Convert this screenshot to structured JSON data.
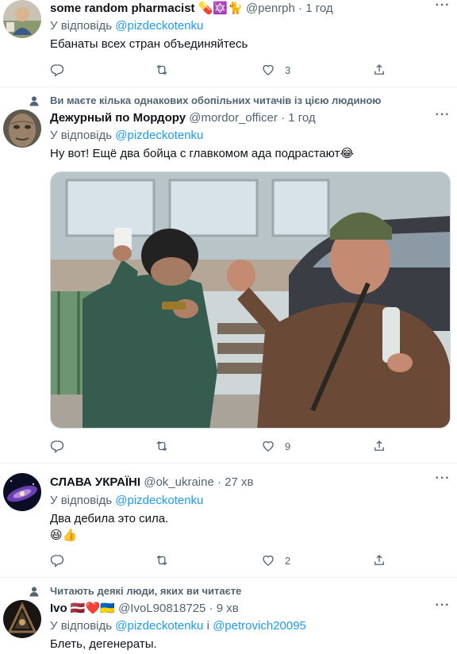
{
  "tweets": [
    {
      "name": "some random pharmacist",
      "name_emoji": "💊🔯🐈",
      "handle": "@penrph",
      "sep": "·",
      "time": "1 год",
      "reply_prefix": "У відповідь",
      "reply_to": "@pizdeckotenku",
      "text": "Ебанаты всех стран объединяйтесь",
      "likes": "3"
    },
    {
      "social_context": "Ви маєте кілька однакових обопільних читачів із цією людиною",
      "name": "Дежурный по Мордору",
      "handle": "@mordor_officer",
      "sep": "·",
      "time": "1 год",
      "reply_prefix": "У відповідь",
      "reply_to": "@pizdeckotenku",
      "text": "Ну вот! Ещё два бойца с главкомом ада подрастают",
      "text_emoji": "😂",
      "likes": "9"
    },
    {
      "name": "СЛАВА УКРАЇНІ",
      "handle": "@ok_ukraine",
      "sep": "·",
      "time": "27 хв",
      "reply_prefix": "У відповідь",
      "reply_to": "@pizdeckotenku",
      "text": "Два дебила это сила.",
      "text_line2": "😆👍",
      "likes": "2"
    },
    {
      "social_context": "Читають деякі люди, яких ви читаєте",
      "name": "Ivo",
      "name_emoji": "🇱🇻❤️🇺🇦",
      "handle": "@IvoL90818725",
      "sep": "·",
      "time": "9 хв",
      "reply_prefix": "У відповідь",
      "reply_to": "@pizdeckotenku",
      "reply_joiner": "і",
      "reply_to_2": "@petrovich20095",
      "text": "Блеть, дегенераты."
    }
  ],
  "icons": {
    "reply": "reply-icon",
    "retweet": "retweet-icon",
    "like": "like-icon",
    "share": "share-icon",
    "more": "more-icon",
    "person": "person-icon"
  },
  "colors": {
    "link": "#1d9bf0",
    "secondary": "#536471",
    "divider": "#eff3f4"
  }
}
